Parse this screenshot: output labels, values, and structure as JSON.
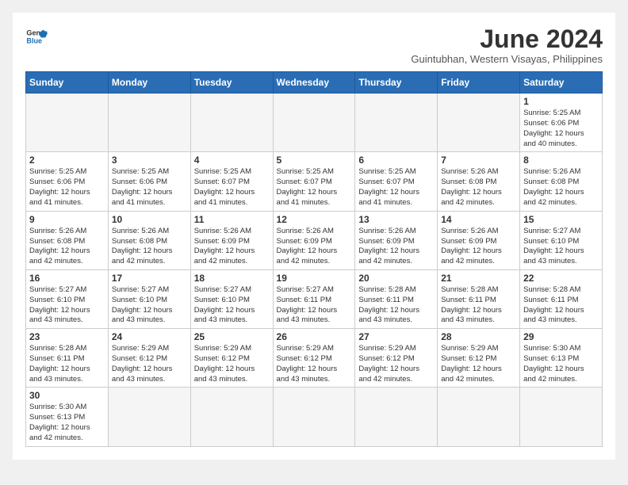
{
  "logo": {
    "text_general": "General",
    "text_blue": "Blue"
  },
  "header": {
    "month_year": "June 2024",
    "location": "Guintubhan, Western Visayas, Philippines"
  },
  "weekdays": [
    "Sunday",
    "Monday",
    "Tuesday",
    "Wednesday",
    "Thursday",
    "Friday",
    "Saturday"
  ],
  "weeks": [
    [
      {
        "day": "",
        "info": ""
      },
      {
        "day": "",
        "info": ""
      },
      {
        "day": "",
        "info": ""
      },
      {
        "day": "",
        "info": ""
      },
      {
        "day": "",
        "info": ""
      },
      {
        "day": "",
        "info": ""
      },
      {
        "day": "1",
        "info": "Sunrise: 5:25 AM\nSunset: 6:06 PM\nDaylight: 12 hours\nand 40 minutes."
      }
    ],
    [
      {
        "day": "2",
        "info": "Sunrise: 5:25 AM\nSunset: 6:06 PM\nDaylight: 12 hours\nand 41 minutes."
      },
      {
        "day": "3",
        "info": "Sunrise: 5:25 AM\nSunset: 6:06 PM\nDaylight: 12 hours\nand 41 minutes."
      },
      {
        "day": "4",
        "info": "Sunrise: 5:25 AM\nSunset: 6:07 PM\nDaylight: 12 hours\nand 41 minutes."
      },
      {
        "day": "5",
        "info": "Sunrise: 5:25 AM\nSunset: 6:07 PM\nDaylight: 12 hours\nand 41 minutes."
      },
      {
        "day": "6",
        "info": "Sunrise: 5:25 AM\nSunset: 6:07 PM\nDaylight: 12 hours\nand 41 minutes."
      },
      {
        "day": "7",
        "info": "Sunrise: 5:26 AM\nSunset: 6:08 PM\nDaylight: 12 hours\nand 42 minutes."
      },
      {
        "day": "8",
        "info": "Sunrise: 5:26 AM\nSunset: 6:08 PM\nDaylight: 12 hours\nand 42 minutes."
      }
    ],
    [
      {
        "day": "9",
        "info": "Sunrise: 5:26 AM\nSunset: 6:08 PM\nDaylight: 12 hours\nand 42 minutes."
      },
      {
        "day": "10",
        "info": "Sunrise: 5:26 AM\nSunset: 6:08 PM\nDaylight: 12 hours\nand 42 minutes."
      },
      {
        "day": "11",
        "info": "Sunrise: 5:26 AM\nSunset: 6:09 PM\nDaylight: 12 hours\nand 42 minutes."
      },
      {
        "day": "12",
        "info": "Sunrise: 5:26 AM\nSunset: 6:09 PM\nDaylight: 12 hours\nand 42 minutes."
      },
      {
        "day": "13",
        "info": "Sunrise: 5:26 AM\nSunset: 6:09 PM\nDaylight: 12 hours\nand 42 minutes."
      },
      {
        "day": "14",
        "info": "Sunrise: 5:26 AM\nSunset: 6:09 PM\nDaylight: 12 hours\nand 42 minutes."
      },
      {
        "day": "15",
        "info": "Sunrise: 5:27 AM\nSunset: 6:10 PM\nDaylight: 12 hours\nand 43 minutes."
      }
    ],
    [
      {
        "day": "16",
        "info": "Sunrise: 5:27 AM\nSunset: 6:10 PM\nDaylight: 12 hours\nand 43 minutes."
      },
      {
        "day": "17",
        "info": "Sunrise: 5:27 AM\nSunset: 6:10 PM\nDaylight: 12 hours\nand 43 minutes."
      },
      {
        "day": "18",
        "info": "Sunrise: 5:27 AM\nSunset: 6:10 PM\nDaylight: 12 hours\nand 43 minutes."
      },
      {
        "day": "19",
        "info": "Sunrise: 5:27 AM\nSunset: 6:11 PM\nDaylight: 12 hours\nand 43 minutes."
      },
      {
        "day": "20",
        "info": "Sunrise: 5:28 AM\nSunset: 6:11 PM\nDaylight: 12 hours\nand 43 minutes."
      },
      {
        "day": "21",
        "info": "Sunrise: 5:28 AM\nSunset: 6:11 PM\nDaylight: 12 hours\nand 43 minutes."
      },
      {
        "day": "22",
        "info": "Sunrise: 5:28 AM\nSunset: 6:11 PM\nDaylight: 12 hours\nand 43 minutes."
      }
    ],
    [
      {
        "day": "23",
        "info": "Sunrise: 5:28 AM\nSunset: 6:11 PM\nDaylight: 12 hours\nand 43 minutes."
      },
      {
        "day": "24",
        "info": "Sunrise: 5:29 AM\nSunset: 6:12 PM\nDaylight: 12 hours\nand 43 minutes."
      },
      {
        "day": "25",
        "info": "Sunrise: 5:29 AM\nSunset: 6:12 PM\nDaylight: 12 hours\nand 43 minutes."
      },
      {
        "day": "26",
        "info": "Sunrise: 5:29 AM\nSunset: 6:12 PM\nDaylight: 12 hours\nand 43 minutes."
      },
      {
        "day": "27",
        "info": "Sunrise: 5:29 AM\nSunset: 6:12 PM\nDaylight: 12 hours\nand 42 minutes."
      },
      {
        "day": "28",
        "info": "Sunrise: 5:29 AM\nSunset: 6:12 PM\nDaylight: 12 hours\nand 42 minutes."
      },
      {
        "day": "29",
        "info": "Sunrise: 5:30 AM\nSunset: 6:13 PM\nDaylight: 12 hours\nand 42 minutes."
      }
    ],
    [
      {
        "day": "30",
        "info": "Sunrise: 5:30 AM\nSunset: 6:13 PM\nDaylight: 12 hours\nand 42 minutes."
      },
      {
        "day": "",
        "info": ""
      },
      {
        "day": "",
        "info": ""
      },
      {
        "day": "",
        "info": ""
      },
      {
        "day": "",
        "info": ""
      },
      {
        "day": "",
        "info": ""
      },
      {
        "day": "",
        "info": ""
      }
    ]
  ]
}
